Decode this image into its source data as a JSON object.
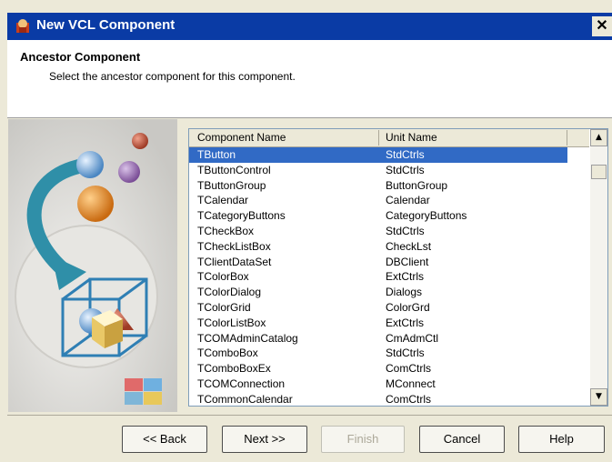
{
  "window": {
    "title": "New VCL Component",
    "close_glyph": "✕"
  },
  "header": {
    "title": "Ancestor Component",
    "description": "Select the ancestor component for this component."
  },
  "list": {
    "columns": [
      "Component Name",
      "Unit Name"
    ],
    "rows": [
      {
        "name": "TButton",
        "unit": "StdCtrls",
        "selected": true
      },
      {
        "name": "TButtonControl",
        "unit": "StdCtrls"
      },
      {
        "name": "TButtonGroup",
        "unit": "ButtonGroup"
      },
      {
        "name": "TCalendar",
        "unit": "Calendar"
      },
      {
        "name": "TCategoryButtons",
        "unit": "CategoryButtons"
      },
      {
        "name": "TCheckBox",
        "unit": "StdCtrls"
      },
      {
        "name": "TCheckListBox",
        "unit": "CheckLst"
      },
      {
        "name": "TClientDataSet",
        "unit": "DBClient"
      },
      {
        "name": "TColorBox",
        "unit": "ExtCtrls"
      },
      {
        "name": "TColorDialog",
        "unit": "Dialogs"
      },
      {
        "name": "TColorGrid",
        "unit": "ColorGrd"
      },
      {
        "name": "TColorListBox",
        "unit": "ExtCtrls"
      },
      {
        "name": "TCOMAdminCatalog",
        "unit": "CmAdmCtl"
      },
      {
        "name": "TComboBox",
        "unit": "StdCtrls"
      },
      {
        "name": "TComboBoxEx",
        "unit": "ComCtrls"
      },
      {
        "name": "TCOMConnection",
        "unit": "MConnect"
      },
      {
        "name": "TCommonCalendar",
        "unit": "ComCtrls"
      }
    ]
  },
  "buttons": {
    "back": "<< Back",
    "next": "Next >>",
    "finish": "Finish",
    "cancel": "Cancel",
    "help": "Help"
  },
  "colors": {
    "title_bar": "#0a3ba5",
    "selection": "#316ac5",
    "dialog_bg": "#ece9d8"
  }
}
